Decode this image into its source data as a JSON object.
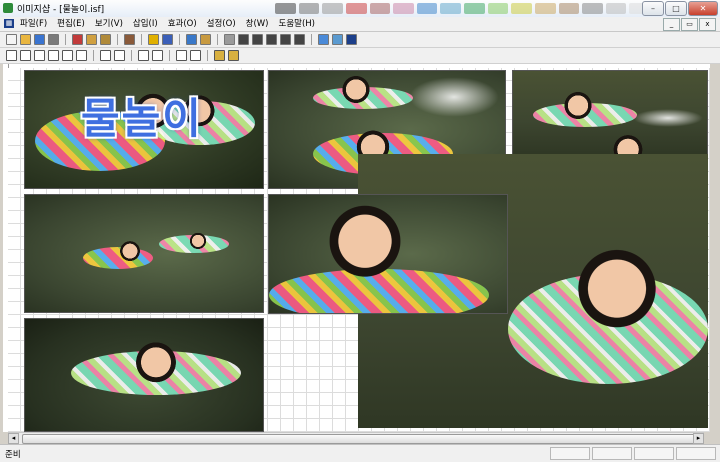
{
  "window": {
    "title": "이미지샵 - [물놀이.isf]",
    "controls": {
      "minimize": "–",
      "maximize": "□",
      "close": "✕"
    }
  },
  "menu": {
    "items": [
      "파일(F)",
      "편집(E)",
      "보기(V)",
      "삽입(I)",
      "효과(O)",
      "설정(O)",
      "창(W)",
      "도움말(H)"
    ],
    "mdi_controls": {
      "minimize": "_",
      "restore": "▭",
      "close": "x"
    }
  },
  "toolbar1": {
    "icons": [
      "new-icon",
      "open-icon",
      "save-icon",
      "print-icon",
      "cut-icon",
      "copy-icon",
      "paste-icon",
      "tools-icon",
      "help-icon",
      "context-help-icon",
      "grid-icon",
      "folder-icon",
      "pointer-icon",
      "line-icon",
      "rectangle-icon",
      "ellipse-icon",
      "round-rect-icon",
      "polygon-icon",
      "image-icon",
      "frame-icon",
      "text-icon"
    ],
    "colors": [
      "#f4f4f4",
      "#e9b640",
      "#3a74d0",
      "#7a7a7a",
      "#c23b3b",
      "#d0a040",
      "#b08a3a",
      "#8a5a3a",
      "#e0b000",
      "#3b5fb8",
      "#3a78c8",
      "#c89a40",
      "#9a9a9a",
      "#444444",
      "#444444",
      "#444444",
      "#444444",
      "#444444",
      "#4a8ad8",
      "#5a9ad0",
      "#1c3f8a"
    ]
  },
  "toolbar2": {
    "icons": [
      "align-left-icon",
      "align-center-icon",
      "align-right-icon",
      "align-top-icon",
      "align-middle-icon",
      "align-bottom-icon",
      "same-width-icon",
      "same-height-icon",
      "bring-front-icon",
      "send-back-icon",
      "group-icon",
      "ungroup-icon",
      "lock-icon",
      "unlock-icon"
    ]
  },
  "canvas": {
    "overlay_text": "물놀이"
  },
  "status": {
    "text": "준비"
  },
  "accent_colors": {
    "overlay_text": "#3f6fe0",
    "canvas_grid": "#dcdcdc"
  }
}
